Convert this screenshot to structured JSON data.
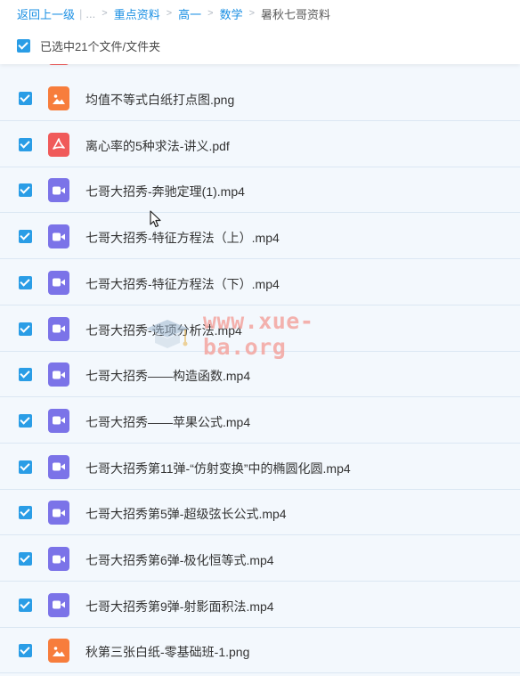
{
  "breadcrumb": {
    "back": "返回上一级",
    "ellipsis": "...",
    "items": [
      "重点资料",
      "高一",
      "数学"
    ],
    "current": "暑秋七哥资料",
    "separator": ">"
  },
  "selection": {
    "text": "已选中21个文件/文件夹",
    "checked": true
  },
  "files": [
    {
      "name": "均值不等式白纸打点图.png",
      "type": "image",
      "checked": true
    },
    {
      "name": "离心率的5种求法-讲义.pdf",
      "type": "pdf",
      "checked": true
    },
    {
      "name": "七哥大招秀-奔驰定理(1).mp4",
      "type": "video",
      "checked": true
    },
    {
      "name": "七哥大招秀-特征方程法（上）.mp4",
      "type": "video",
      "checked": true
    },
    {
      "name": "七哥大招秀-特征方程法（下）.mp4",
      "type": "video",
      "checked": true
    },
    {
      "name": "七哥大招秀-选项分析法.mp4",
      "type": "video",
      "checked": true
    },
    {
      "name": "七哥大招秀——构造函数.mp4",
      "type": "video",
      "checked": true
    },
    {
      "name": "七哥大招秀——苹果公式.mp4",
      "type": "video",
      "checked": true
    },
    {
      "name": "七哥大招秀第11弹-“仿射变换”中的椭圆化圆.mp4",
      "type": "video",
      "checked": true
    },
    {
      "name": "七哥大招秀第5弹-超级弦长公式.mp4",
      "type": "video",
      "checked": true
    },
    {
      "name": "七哥大招秀第6弹-极化恒等式.mp4",
      "type": "video",
      "checked": true
    },
    {
      "name": "七哥大招秀第9弹-射影面积法.mp4",
      "type": "video",
      "checked": true
    },
    {
      "name": "秋第三张白纸-零基础班-1.png",
      "type": "image",
      "checked": true
    }
  ],
  "watermark": "www.xue-ba.org",
  "colors": {
    "accent": "#2a9de6",
    "link": "#1a8fe3",
    "image_icon": "#f77d3c",
    "pdf_icon": "#f05a5a",
    "video_icon": "#7b73e8",
    "row_bg": "#f3f8fd"
  },
  "icons": {
    "image": "image-file-icon",
    "pdf": "pdf-file-icon",
    "video": "video-file-icon"
  }
}
